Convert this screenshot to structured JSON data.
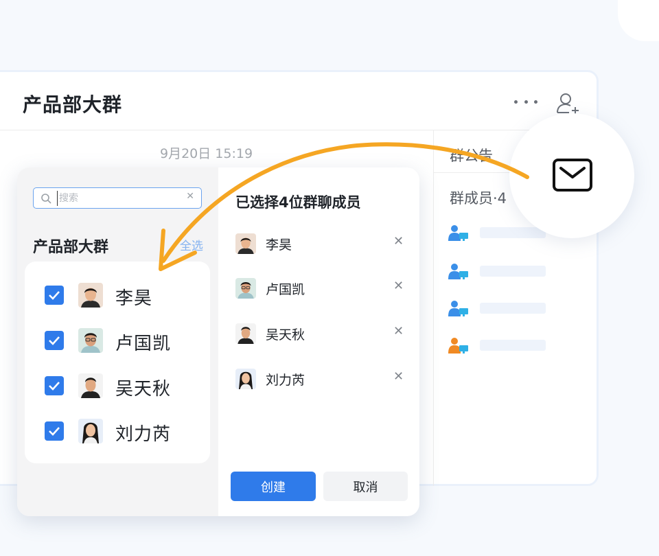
{
  "chat": {
    "title": "产品部大群",
    "timestamp": "9月20日 15:19",
    "announcement_label": "群公告",
    "members_label": "群成员·4"
  },
  "colors": {
    "accent": "#2f7bea",
    "member_blue": "#3b8fe8",
    "member_orange": "#f08a24",
    "arrow": "#f5a623"
  },
  "picker": {
    "search_placeholder": "搜索",
    "group_name": "产品部大群",
    "select_all": "全选",
    "members": [
      {
        "name": "李昊",
        "checked": true
      },
      {
        "name": "卢国凯",
        "checked": true
      },
      {
        "name": "吴天秋",
        "checked": true
      },
      {
        "name": "刘力芮",
        "checked": true
      }
    ],
    "selected_title": "已选择4位群聊成员",
    "selected": [
      {
        "name": "李昊"
      },
      {
        "name": "卢国凯"
      },
      {
        "name": "吴天秋"
      },
      {
        "name": "刘力芮"
      }
    ],
    "create_label": "创建",
    "cancel_label": "取消"
  },
  "icons": {
    "more": "more-icon",
    "add_member": "add-member-icon",
    "mail": "mail-icon",
    "search": "search-icon",
    "clear": "clear-icon",
    "remove": "remove-icon"
  }
}
